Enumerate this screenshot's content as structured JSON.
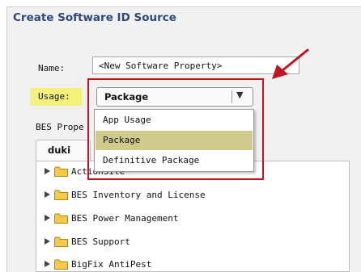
{
  "dialog": {
    "title": "Create Software ID Source",
    "name_label": "Name:",
    "name_value": "<New Software Property>",
    "usage_label": "Usage:",
    "bes_label": "BES Prope",
    "usage_select": {
      "selected": "Package",
      "arrow": "▼",
      "options": [
        "App Usage",
        "Package",
        "Definitive Package"
      ],
      "selected_index": 1
    }
  },
  "tabs": [
    {
      "label": "duki"
    }
  ],
  "tree": {
    "items": [
      {
        "label": "ActionSite"
      },
      {
        "label": "BES Inventory and License"
      },
      {
        "label": "BES Power Management"
      },
      {
        "label": "BES Support"
      },
      {
        "label": "BigFix AntiPest"
      }
    ]
  },
  "colors": {
    "title": "#2c4a79",
    "highlight": "#f5f27a",
    "selected_option": "#cfcb8a",
    "annotation_red": "#c2151f",
    "folder": "#f6c94a"
  },
  "icons": {
    "expand": "triangle-right-icon",
    "folder": "folder-icon",
    "annotation": "red-arrow-icon"
  }
}
